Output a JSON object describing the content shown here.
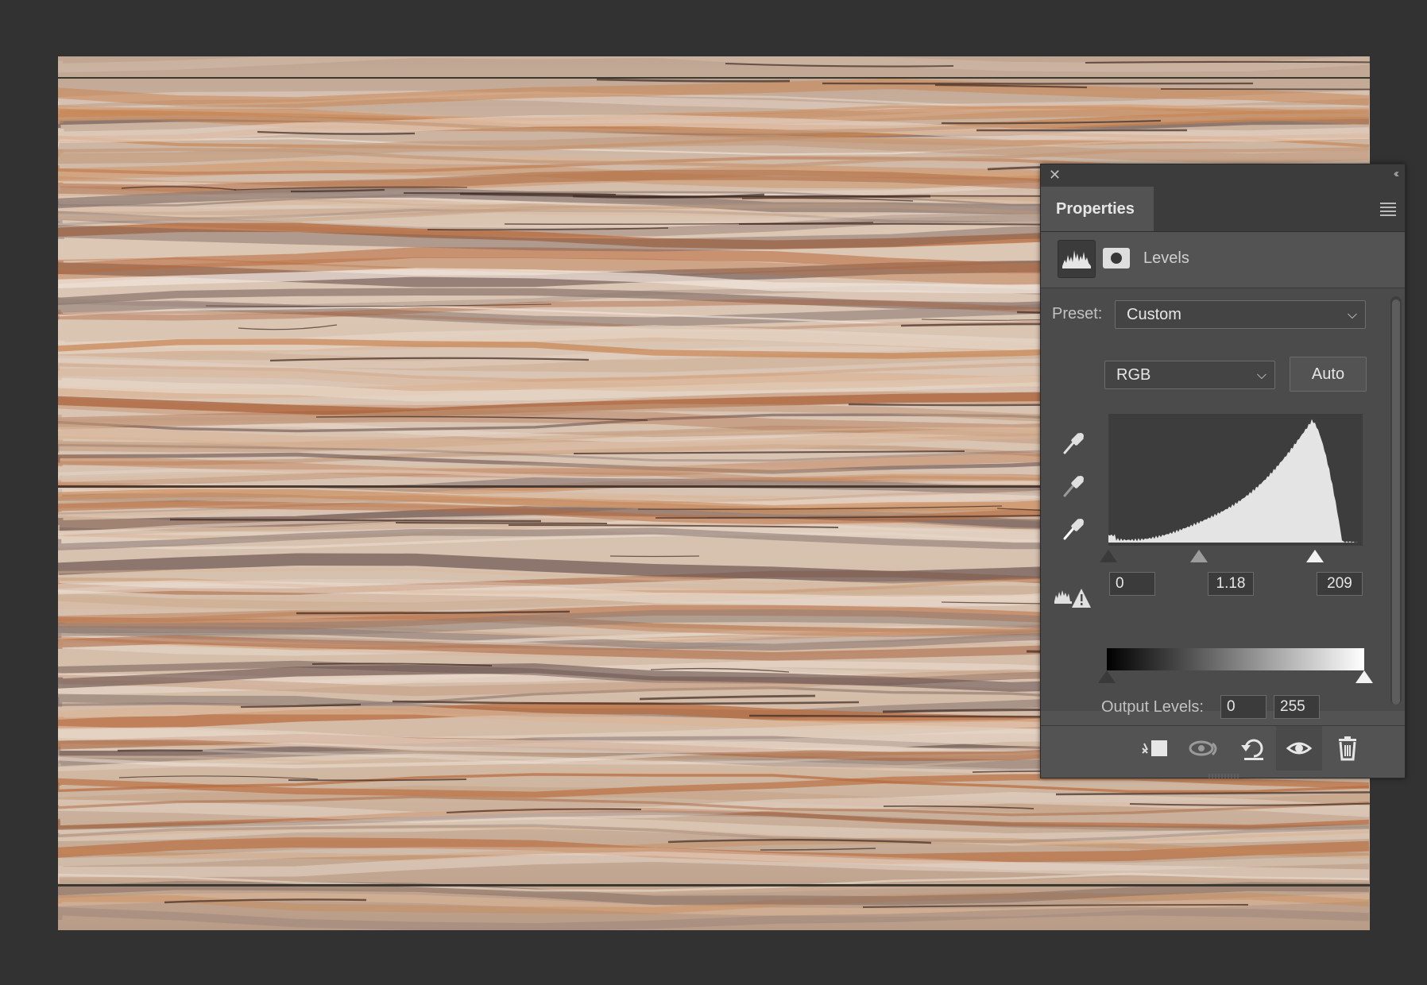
{
  "panel": {
    "tab_title": "Properties",
    "adjustment_name": "Levels",
    "preset_label": "Preset:",
    "preset_value": "Custom",
    "channel_value": "RGB",
    "auto_label": "Auto",
    "input_levels": {
      "black": "0",
      "gamma": "1.18",
      "white": "209"
    },
    "output_levels_label": "Output Levels:",
    "output_levels": {
      "black": "0",
      "white": "255"
    },
    "input_sliders": {
      "black": 0,
      "gamma": 1.18,
      "white": 209
    },
    "output_sliders": {
      "black": 0,
      "white": 255
    }
  },
  "icons": {
    "close": "close-icon",
    "collapse": "collapse-icon",
    "menu": "panel-menu-icon",
    "eyedroppers": [
      "black-point-eyedropper-icon",
      "gray-point-eyedropper-icon",
      "white-point-eyedropper-icon"
    ],
    "clipping_warning": "histogram-warning-icon",
    "footer": [
      "clip-to-layer-icon",
      "view-previous-state-icon",
      "reset-icon",
      "toggle-visibility-icon",
      "delete-icon"
    ]
  },
  "colors": {
    "panel_bg": "#535353",
    "app_bg": "#323232",
    "accent_text": "#e6e6e6"
  }
}
